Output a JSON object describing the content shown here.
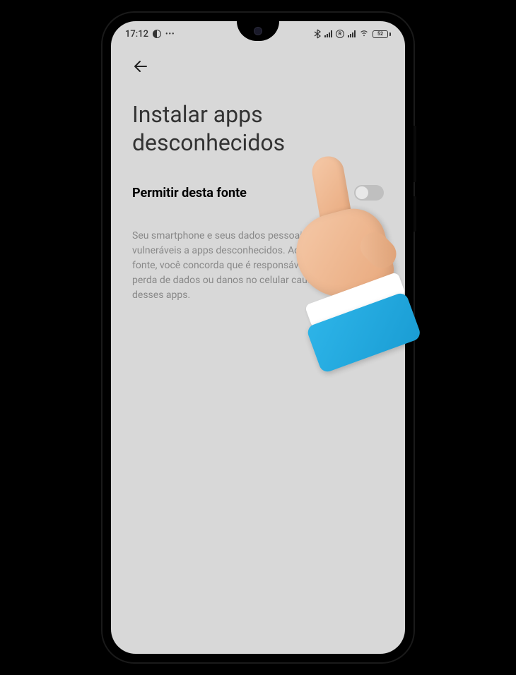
{
  "status_bar": {
    "time": "17:12",
    "battery_level": "52",
    "bluetooth_icon": "bluetooth",
    "registered_symbol": "R"
  },
  "navigation": {
    "back_icon": "←"
  },
  "page": {
    "title": "Instalar apps desconhecidos"
  },
  "setting": {
    "label": "Permitir desta fonte",
    "enabled": false
  },
  "description": {
    "text": "Seu smartphone e seus dados pessoais estão mais vulneráveis a apps desconhecidos. Ao instalar desta fonte, você concorda que é responsável por qualquer perda de dados ou danos no celular causados pelo uso desses apps."
  }
}
